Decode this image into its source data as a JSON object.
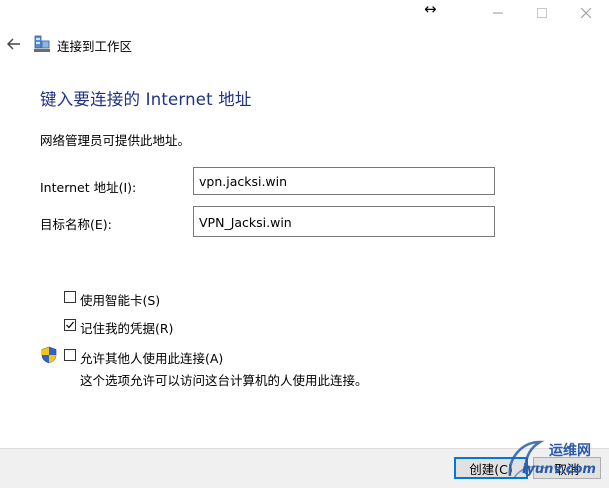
{
  "window": {
    "title": "连接到工作区"
  },
  "heading": "键入要连接的 Internet 地址",
  "description": "网络管理员可提供此地址。",
  "fields": {
    "internet_address": {
      "label": "Internet 地址(I):",
      "value": "vpn.jacksi.win"
    },
    "destination_name": {
      "label": "目标名称(E):",
      "value": "VPN_Jacksi.win"
    }
  },
  "options": {
    "smart_card": {
      "label": "使用智能卡(S)",
      "checked": false
    },
    "remember_credentials": {
      "label": "记住我的凭据(R)",
      "checked": true
    },
    "allow_others": {
      "label": "允许其他人使用此连接(A)",
      "checked": false,
      "sub_text": "这个选项允许可以访问这台计算机的人使用此连接。"
    }
  },
  "buttons": {
    "create": "创建(C)",
    "cancel": "取消"
  },
  "watermark": {
    "cn": "运维网",
    "en": "iyunv.com"
  },
  "icons": {
    "back": "back-arrow-icon",
    "app": "network-workplace-icon",
    "shield": "uac-shield-icon",
    "resize": "resize-horizontal-icon"
  },
  "colors": {
    "heading": "#1e3287",
    "focus_border": "#0078d7",
    "footer_bg": "#f0f0f0"
  }
}
